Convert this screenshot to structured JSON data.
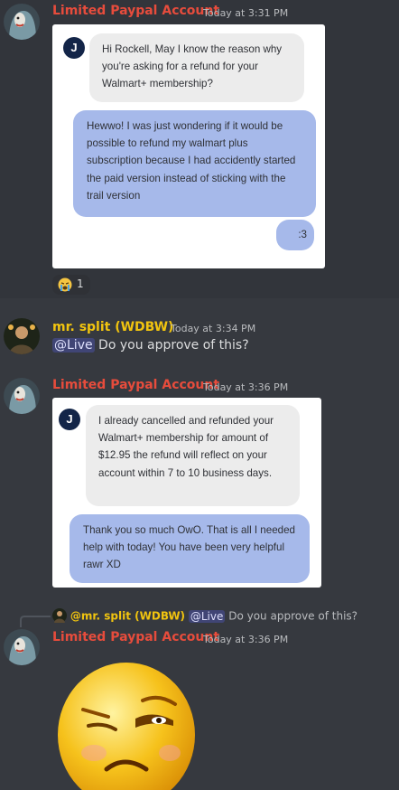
{
  "colors": {
    "background": "#36393f",
    "username_red": "#e74c3c",
    "username_yellow": "#f1c40f",
    "bubble_out": "#a6b9ea",
    "bubble_in": "#ececec"
  },
  "messages": [
    {
      "username": "Limited Paypal Account",
      "timestamp": "Today at 3:31 PM",
      "card": {
        "agent_avatar_letter": "J",
        "bubbles": [
          {
            "side": "agent",
            "text": "Hi Rockell, May I know the reason why you're asking for a refund for your Walmart+ membership?"
          },
          {
            "side": "user",
            "text": "Hewwo! I was just wondering if it would be possible to refund my walmart plus subscription because I had accidently started the paid version instead of sticking with the trail version"
          },
          {
            "side": "user",
            "text": ":3"
          }
        ]
      },
      "reaction": {
        "emoji": "cry-emoji",
        "count": "1"
      }
    },
    {
      "username": "mr. split (WDBW)",
      "timestamp": "Today at 3:34 PM",
      "mention": "@Live",
      "text": "Do you approve of this?"
    },
    {
      "username": "Limited Paypal Account",
      "timestamp": "Today at 3:36 PM",
      "card": {
        "agent_avatar_letter": "J",
        "bubbles": [
          {
            "side": "agent",
            "text": "I already cancelled and refunded your Walmart+ membership for amount of $12.95 the refund will reflect on your account within 7 to 10 business days."
          },
          {
            "side": "user",
            "text": "Thank you so much OwO. That is all I needed help with today! You have been very helpful rawr XD"
          }
        ]
      }
    },
    {
      "reply": {
        "username": "@mr. split (WDBW)",
        "mention": "@Live",
        "text": "Do you approve of this?"
      },
      "username": "Limited Paypal Account",
      "timestamp": "Today at 3:36 PM",
      "image": "skeptical-emoji"
    }
  ]
}
